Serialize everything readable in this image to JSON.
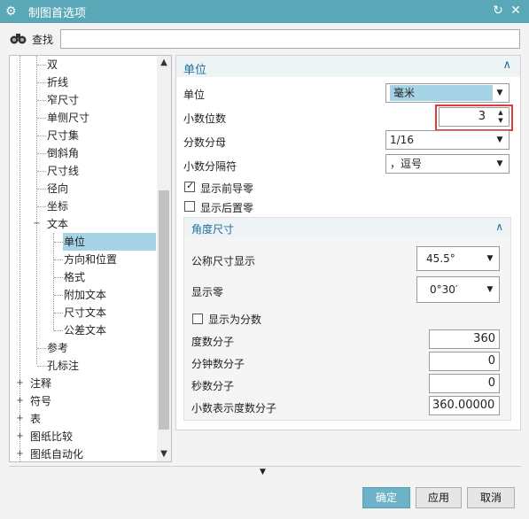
{
  "window": {
    "title": "制图首选项"
  },
  "search": {
    "label": "查找",
    "value": ""
  },
  "tree": {
    "items": [
      {
        "label": "双"
      },
      {
        "label": "折线"
      },
      {
        "label": "窄尺寸"
      },
      {
        "label": "单侧尺寸"
      },
      {
        "label": "尺寸集"
      },
      {
        "label": "倒斜角"
      },
      {
        "label": "尺寸线"
      },
      {
        "label": "径向"
      },
      {
        "label": "坐标"
      },
      {
        "label": "文本"
      },
      {
        "label": "单位"
      },
      {
        "label": "方向和位置"
      },
      {
        "label": "格式"
      },
      {
        "label": "附加文本"
      },
      {
        "label": "尺寸文本"
      },
      {
        "label": "公差文本"
      },
      {
        "label": "参考"
      },
      {
        "label": "孔标注"
      },
      {
        "label": "注释"
      },
      {
        "label": "符号"
      },
      {
        "label": "表"
      },
      {
        "label": "图纸比较"
      },
      {
        "label": "图纸自动化"
      }
    ],
    "selected": "单位"
  },
  "units_section": {
    "title": "单位",
    "unit_label": "单位",
    "unit_value": "毫米",
    "decimal_places_label": "小数位数",
    "decimal_places_value": "3",
    "fraction_denominator_label": "分数分母",
    "fraction_denominator_value": "1/16",
    "decimal_separator_label": "小数分隔符",
    "decimal_separator_value": "，逗号",
    "show_leading_zeros_label": "显示前导零",
    "show_leading_zeros": true,
    "show_trailing_zeros_label": "显示后置零",
    "show_trailing_zeros": false
  },
  "angle_section": {
    "title": "角度尺寸",
    "nominal_display_label": "公称尺寸显示",
    "nominal_display_value": "45.5°",
    "show_zeros_label": "显示零",
    "show_zeros_value": "0°30′",
    "show_as_fraction_label": "显示为分数",
    "show_as_fraction": false,
    "degree_numerator_label": "度数分子",
    "degree_numerator_value": "360",
    "minute_numerator_label": "分钟数分子",
    "minute_numerator_value": "0",
    "second_numerator_label": "秒数分子",
    "second_numerator_value": "0",
    "decimal_degree_numerator_label": "小数表示度数分子",
    "decimal_degree_numerator_value": "360.00000"
  },
  "buttons": {
    "ok": "确定",
    "apply": "应用",
    "cancel": "取消"
  }
}
